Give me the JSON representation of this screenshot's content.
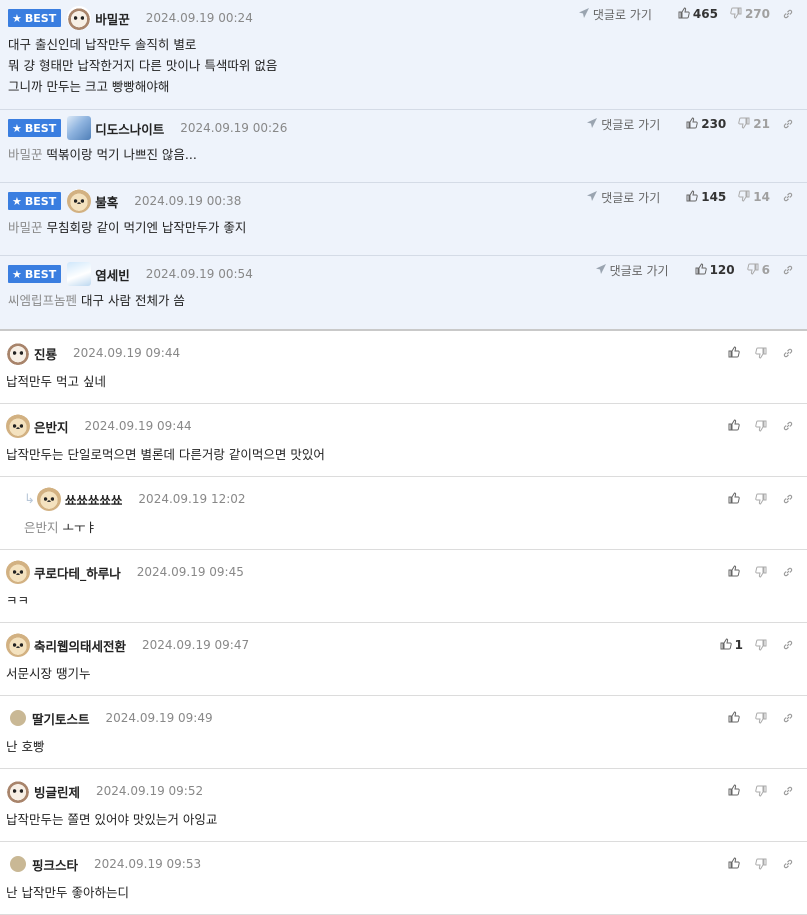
{
  "best_label": "BEST",
  "goto_label": "댓글로 가기",
  "best_comments": [
    {
      "avatar": "dog",
      "name": "바밀꾼",
      "time": "2024.09.19 00:24",
      "up": "465",
      "down": "270",
      "mention": "",
      "lines": [
        "대구 출신인데 납작만두 솔직히 별로",
        "뭐 걍 형태만 납작한거지 다른 맛이나 특색따위 없음",
        "그니까 만두는 크고 빵빵해야해"
      ]
    },
    {
      "avatar": "cube",
      "name": "디도스나이트",
      "time": "2024.09.19 00:26",
      "up": "230",
      "down": "21",
      "mention": "바밀꾼",
      "lines": [
        "떡볶이랑 먹기 나쁘진 않음..."
      ]
    },
    {
      "avatar": "puppy",
      "name": "불혹",
      "time": "2024.09.19 00:38",
      "up": "145",
      "down": "14",
      "mention": "바밀꾼",
      "lines": [
        "무침회랑 같이 먹기엔 납작만두가 좋지"
      ]
    },
    {
      "avatar": "fox",
      "name": "염세빈",
      "time": "2024.09.19 00:54",
      "up": "120",
      "down": "6",
      "mention": "씨엠립프놈펜",
      "lines": [
        "대구 사람 전체가 씀"
      ]
    }
  ],
  "comments": [
    {
      "avatar": "dog",
      "name": "진룡",
      "time": "2024.09.19 09:44",
      "up": "",
      "reply": false,
      "mention": "",
      "text": "납적만두 먹고 싶네"
    },
    {
      "avatar": "puppy",
      "name": "은반지",
      "time": "2024.09.19 09:44",
      "up": "",
      "reply": false,
      "mention": "",
      "text": "납작만두는 단일로먹으면 별론데 다른거랑 같이먹으면 맛있어"
    },
    {
      "avatar": "puppy",
      "name": "쑈쑈쑈쑈쑈",
      "time": "2024.09.19 12:02",
      "up": "",
      "reply": true,
      "mention": "은반지",
      "text": "ㅗㅜㅑ"
    },
    {
      "avatar": "puppy",
      "name": "쿠로다테_하루나",
      "time": "2024.09.19 09:45",
      "up": "",
      "reply": false,
      "mention": "",
      "text": "ㅋㅋ"
    },
    {
      "avatar": "puppy",
      "name": "축리웹의태세전환",
      "time": "2024.09.19 09:47",
      "up": "1",
      "reply": false,
      "mention": "",
      "text": "서문시장 땡기누"
    },
    {
      "avatar": "plain",
      "name": "딸기토스트",
      "time": "2024.09.19 09:49",
      "up": "",
      "reply": false,
      "mention": "",
      "text": "난 호빵"
    },
    {
      "avatar": "dog",
      "name": "빙글린제",
      "time": "2024.09.19 09:52",
      "up": "",
      "reply": false,
      "mention": "",
      "text": "납작만두는 쫄면 있어야 맛있는거 아잉교"
    },
    {
      "avatar": "plain",
      "name": "핑크스타",
      "time": "2024.09.19 09:53",
      "up": "",
      "reply": false,
      "mention": "",
      "text": "난 납작만두 좋아하는디"
    }
  ]
}
